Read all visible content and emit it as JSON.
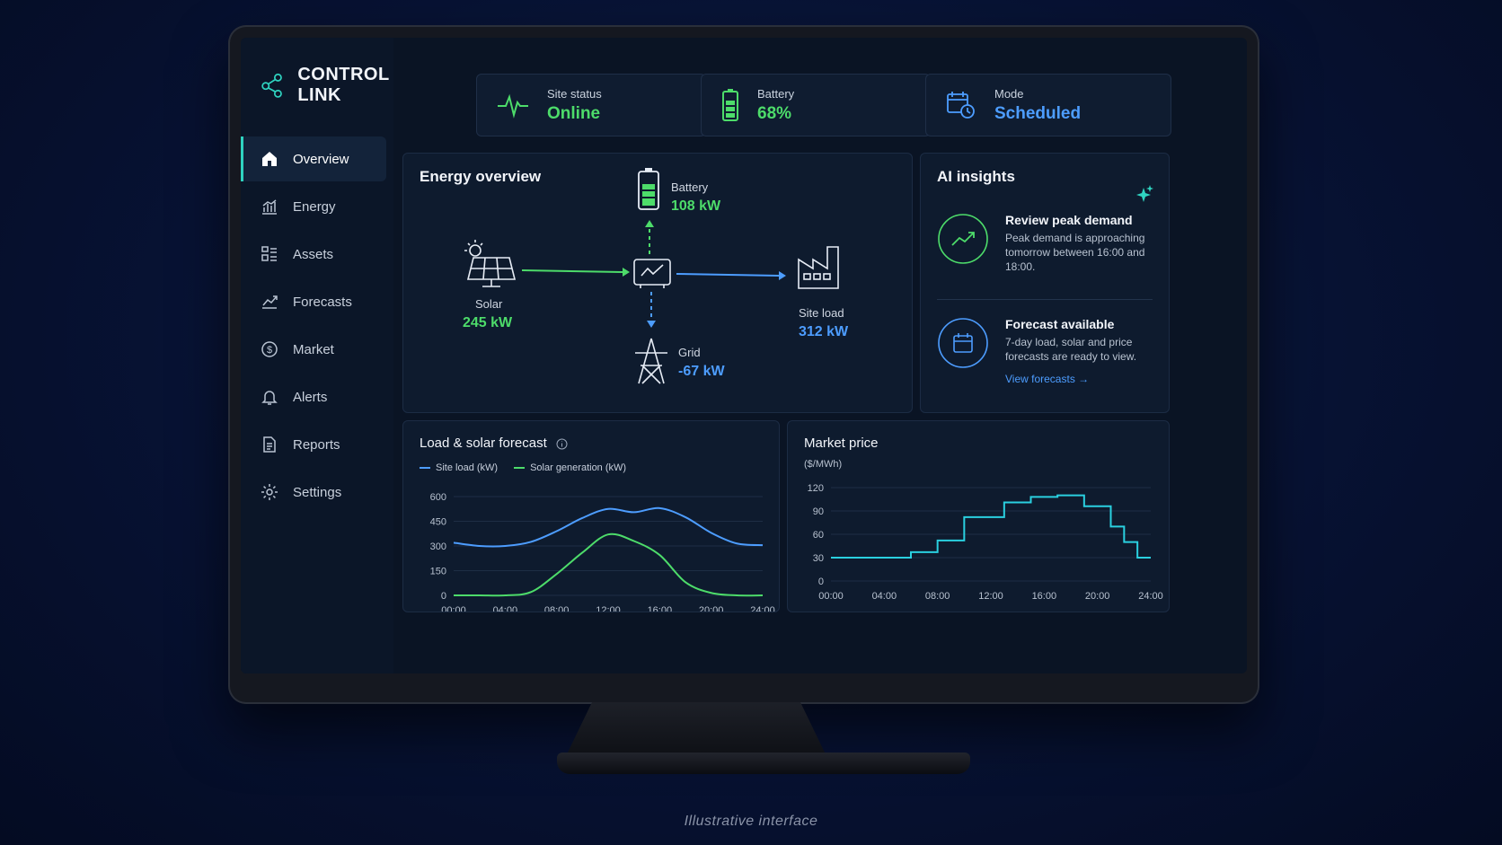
{
  "brand": {
    "name": "CONTROL LINK"
  },
  "nav": [
    {
      "label": "Overview",
      "icon": "home-icon"
    },
    {
      "label": "Energy",
      "icon": "bar-chart-icon"
    },
    {
      "label": "Assets",
      "icon": "assets-icon"
    },
    {
      "label": "Forecasts",
      "icon": "trend-icon"
    },
    {
      "label": "Market",
      "icon": "dollar-icon"
    },
    {
      "label": "Alerts",
      "icon": "bell-icon"
    },
    {
      "label": "Reports",
      "icon": "document-icon"
    },
    {
      "label": "Settings",
      "icon": "gear-icon"
    }
  ],
  "status": {
    "site": {
      "label": "Site status",
      "value": "Online"
    },
    "battery": {
      "label": "Battery",
      "value": "68%"
    },
    "mode": {
      "label": "Mode",
      "value": "Scheduled"
    }
  },
  "energy": {
    "title": "Energy overview",
    "battery": {
      "label": "Battery",
      "value": "108 kW"
    },
    "solar": {
      "label": "Solar",
      "value": "245 kW"
    },
    "site_load": {
      "label": "Site load",
      "value": "312 kW"
    },
    "grid": {
      "label": "Grid",
      "value": "-67 kW"
    }
  },
  "insights": {
    "title": "AI insights",
    "items": [
      {
        "title": "Review peak demand",
        "text": "Peak demand is approaching tomorrow between 16:00 and 18:00."
      },
      {
        "title": "Forecast available",
        "text": "7-day load, solar and price forecasts are ready to view.",
        "link": "View forecasts"
      }
    ]
  },
  "colors": {
    "accent": "#2fd3c0",
    "green": "#4ddc6a",
    "blue": "#4d9dff",
    "cyan": "#2ad0e0"
  },
  "chart_data": [
    {
      "type": "line",
      "title": "Load & solar forecast",
      "x": [
        "00:00",
        "02:00",
        "04:00",
        "06:00",
        "08:00",
        "10:00",
        "12:00",
        "14:00",
        "16:00",
        "18:00",
        "20:00",
        "22:00",
        "24:00"
      ],
      "series": [
        {
          "name": "Site load (kW)",
          "values": [
            320,
            300,
            300,
            325,
            390,
            470,
            525,
            505,
            530,
            475,
            380,
            315,
            305
          ]
        },
        {
          "name": "Solar generation (kW)",
          "values": [
            0,
            0,
            0,
            20,
            130,
            260,
            370,
            330,
            245,
            80,
            15,
            0,
            0
          ]
        }
      ],
      "yticks": [
        0,
        150,
        300,
        450,
        600
      ],
      "xticks": [
        "00:00",
        "04:00",
        "08:00",
        "12:00",
        "16:00",
        "20:00",
        "24:00"
      ],
      "ylim": [
        0,
        600
      ]
    },
    {
      "type": "line",
      "title": "Market price",
      "ylabel": "($/MWh)",
      "x": [
        0,
        1,
        2,
        3,
        4,
        5,
        6,
        7,
        8,
        9,
        10,
        11,
        12,
        13,
        14,
        15,
        16,
        17,
        18,
        19,
        20,
        21,
        22,
        23,
        24
      ],
      "step": true,
      "values": [
        30,
        30,
        30,
        30,
        30,
        30,
        37,
        37,
        52,
        52,
        82,
        82,
        82,
        101,
        101,
        108,
        108,
        110,
        110,
        96,
        96,
        70,
        50,
        30,
        30
      ],
      "yticks": [
        0,
        30,
        60,
        90,
        120
      ],
      "xticks": [
        "00:00",
        "04:00",
        "08:00",
        "12:00",
        "16:00",
        "20:00",
        "24:00"
      ],
      "ylim": [
        0,
        120
      ]
    }
  ],
  "caption": "Illustrative interface"
}
